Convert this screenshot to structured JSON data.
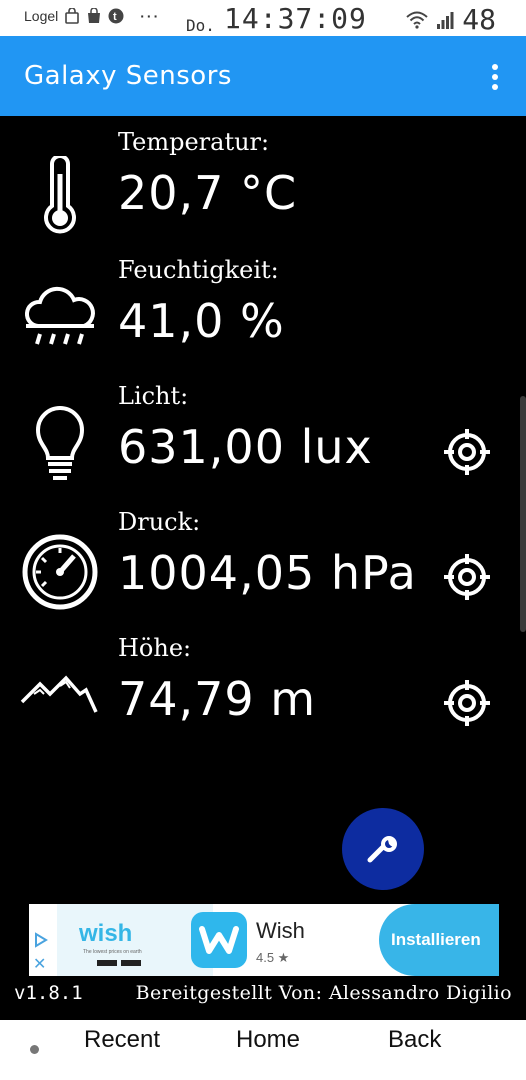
{
  "status_bar": {
    "carrier": "Logel",
    "date": "Do.",
    "time": "14:37:09",
    "battery": "48",
    "more": "···"
  },
  "app_bar": {
    "title": "Galaxy Sensors"
  },
  "sensors": [
    {
      "label": "Temperatur:",
      "value": "20,7 °C",
      "icon": "thermometer-icon",
      "has_target": false
    },
    {
      "label": "Feuchtigkeit:",
      "value": "41,0 %",
      "icon": "cloud-rain-icon",
      "has_target": false
    },
    {
      "label": "Licht:",
      "value": "631,00 lux",
      "icon": "lightbulb-icon",
      "has_target": true
    },
    {
      "label": "Druck:",
      "value": "1004,05 hPa",
      "icon": "gauge-icon",
      "has_target": true
    },
    {
      "label": "Höhe:",
      "value": "74,79 m",
      "icon": "mountain-icon",
      "has_target": true
    }
  ],
  "ad": {
    "banner_word": "wish",
    "banner_tagline": "The lowest prices on earth",
    "app_name": "Wish",
    "rating": "4.5 ★",
    "install_label": "Installieren"
  },
  "footer": {
    "version": "v1.8.1",
    "credit": "Bereitgestellt Von: Alessandro Digilio"
  },
  "nav_bar": {
    "recent": "Recent",
    "home": "Home",
    "back": "Back"
  },
  "colors": {
    "app_bar": "#2196f3",
    "fab": "#0d2ca0",
    "background": "#000000",
    "ad_accent": "#38b5e8"
  }
}
